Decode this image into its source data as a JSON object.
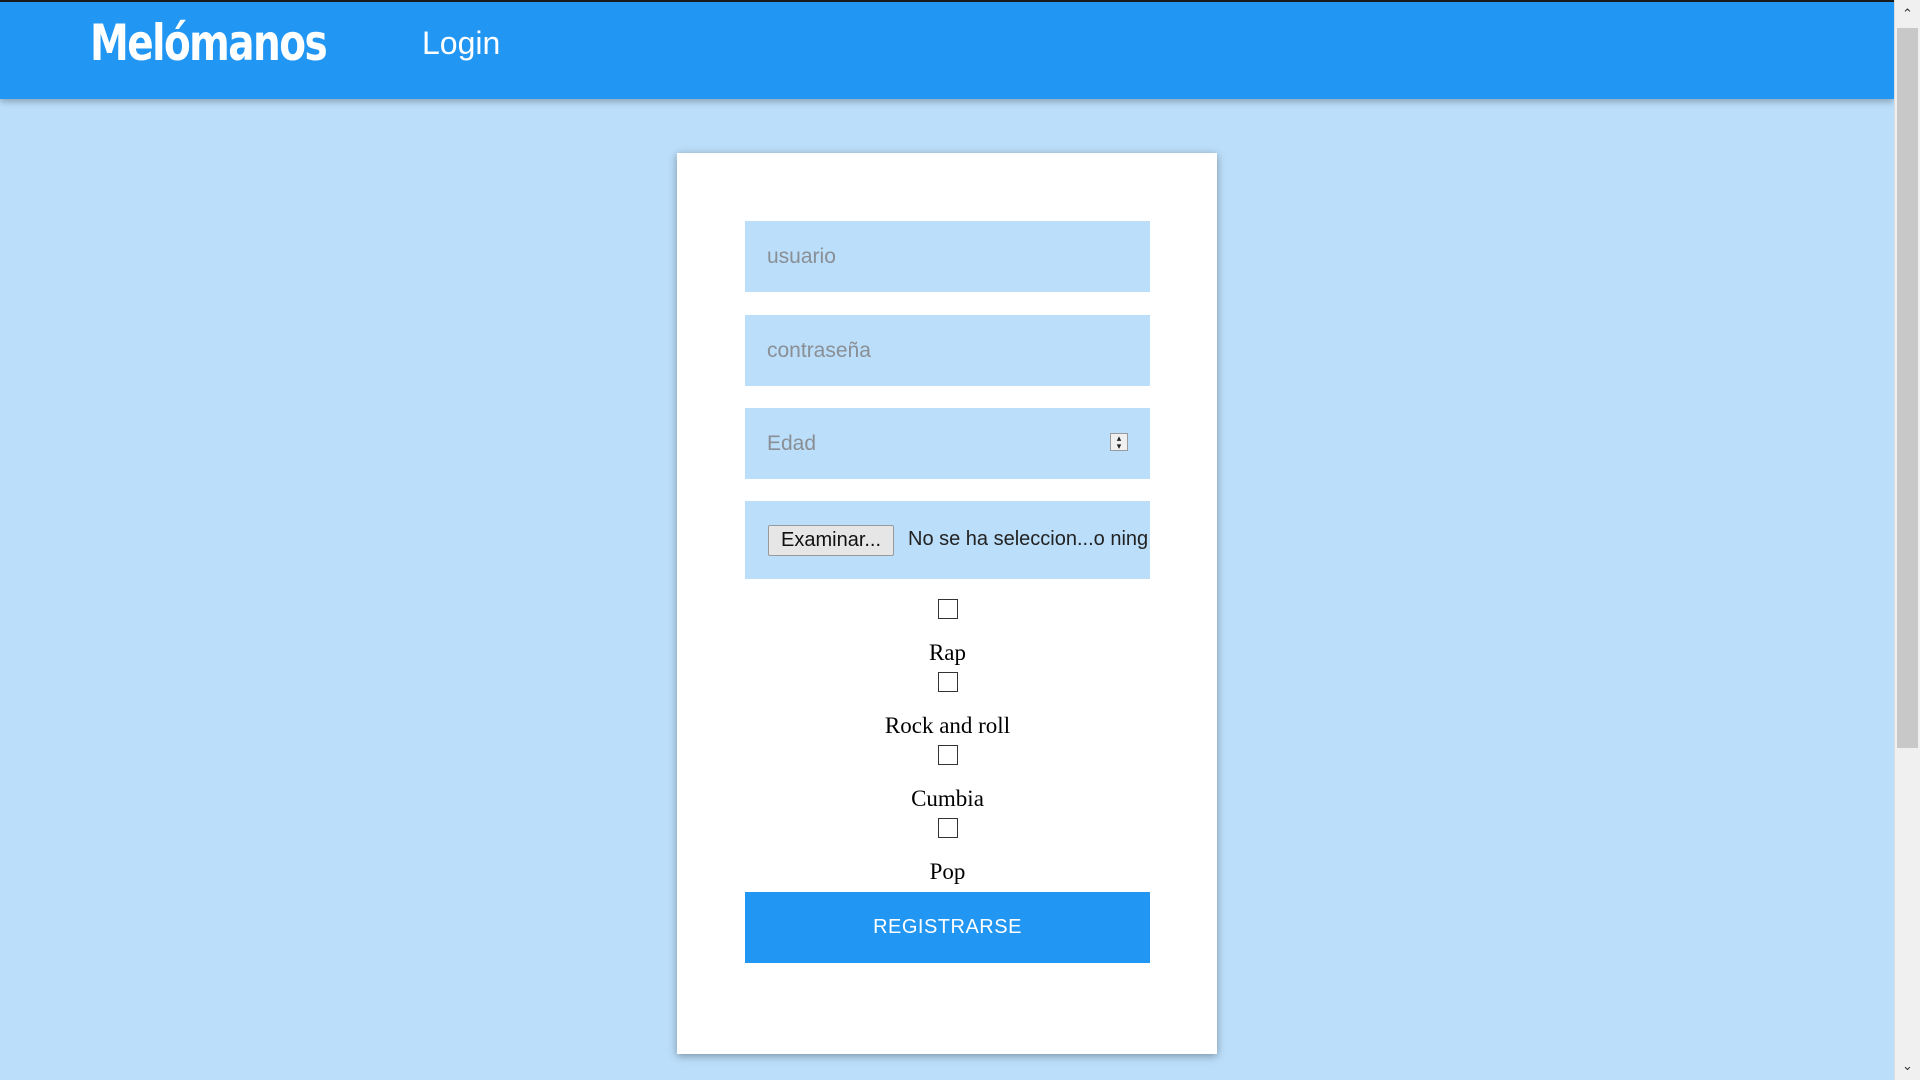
{
  "header": {
    "brand": "Melómanos",
    "nav_login": "Login"
  },
  "form": {
    "username_placeholder": "usuario",
    "password_placeholder": "contraseña",
    "age_placeholder": "Edad",
    "file_button": "Examinar...",
    "file_status": "No se ha seleccion...o ning",
    "genres": [
      {
        "label": "Rap",
        "checked": false
      },
      {
        "label": "Rock and roll",
        "checked": false
      },
      {
        "label": "Cumbia",
        "checked": false
      },
      {
        "label": "Pop",
        "checked": false
      }
    ],
    "submit_label": "REGISTRARSE"
  },
  "colors": {
    "primary": "#2196F3",
    "background": "#BBDEFA",
    "card": "#FFFFFF"
  },
  "icons": {
    "spinner": "number-spinner-icon",
    "scroll_up": "chevron-up-icon",
    "scroll_down": "chevron-down-icon"
  }
}
